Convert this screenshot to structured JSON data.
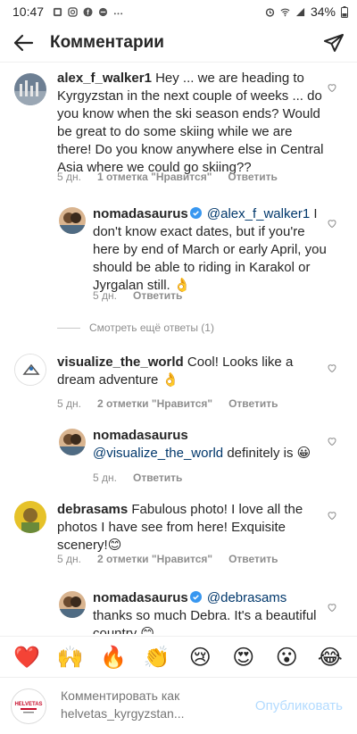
{
  "status_bar": {
    "time": "10:47",
    "battery": "34%"
  },
  "header": {
    "title": "Комментарии"
  },
  "comments": [
    {
      "username": "alex_f_walker1",
      "text": "Hey ... we are heading to Kyrgyzstan in the next couple of weeks ... do you know when the ski season ends? Would be great to do some skiing while we are there! Do you know anywhere else in Central Asia where we could go skiing??",
      "time": "5 дн.",
      "likes": "1 отметка \"Нравится\"",
      "reply_label": "Ответить"
    },
    {
      "username": "nomadasaurus",
      "mention": "@alex_f_walker1",
      "text": "I don't know exact dates, but if you're here by end of March or early April, you should be able to riding in Karakol or Jyrgalan still. 👌",
      "time": "5 дн.",
      "reply_label": "Ответить"
    },
    {
      "more_replies": "Смотреть ещё ответы (1)"
    },
    {
      "username": "visualize_the_world",
      "text": "Cool! Looks like a dream adventure 👌",
      "time": "5 дн.",
      "likes": "2 отметки \"Нравится\"",
      "reply_label": "Ответить"
    },
    {
      "username": "nomadasaurus",
      "mention": "@visualize_the_world",
      "text": "definitely is 😀",
      "time": "5 дн.",
      "reply_label": "Ответить"
    },
    {
      "username": "debrasams",
      "text": "Fabulous photo! I love all the photos I have see from here! Exquisite scenery!😊",
      "time": "5 дн.",
      "likes": "2 отметки \"Нравится\"",
      "reply_label": "Ответить"
    },
    {
      "username": "nomadasaurus",
      "mention": "@debrasams",
      "text": "thanks so much Debra. It's a beautiful country 😊"
    }
  ],
  "emoji_bar": [
    "❤️",
    "🙌",
    "🔥",
    "👏",
    "😢",
    "😍",
    "😮",
    "😂"
  ],
  "input": {
    "placeholder": "Комментировать как helvetas_kyrgyzstan...",
    "publish_label": "Опубликовать",
    "avatar_text": "HELVETAS"
  },
  "colors": {
    "accent": "#0095f6",
    "publish_disabled": "#b3dbff",
    "verified": "#3897f0",
    "mention": "#00376b",
    "meta": "#8e8e8e"
  }
}
